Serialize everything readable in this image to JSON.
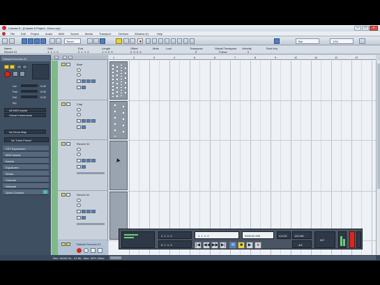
{
  "window": {
    "title": "Cubase 5 - [Cubase 5 Project - Demo.cpr]",
    "controls": [
      "–",
      "□",
      "×"
    ]
  },
  "menu": {
    "items": [
      "File",
      "Edit",
      "Project",
      "Audio",
      "MIDI",
      "Scores",
      "Media",
      "Transport",
      "Devices",
      "Window (1)",
      "Help"
    ]
  },
  "toolbar": {
    "mode_select": "Touch",
    "grid_select": "Bar",
    "quantize_select": "1/16"
  },
  "infoline": {
    "headers": [
      "Name",
      "Start",
      "End",
      "Length",
      "Offset",
      "Mute",
      "Lock",
      "Transpose",
      "Global Transpose",
      "Velocity",
      "Root Key"
    ],
    "values": [
      "Reverb 01",
      "1. 1. 1. 0",
      "2. 1. 1. 0",
      "1. 0. 0. 0",
      "0. 0. 0. 0",
      "",
      "",
      "0",
      "Follow",
      "0",
      "-"
    ]
  },
  "inspector": {
    "track_name": "Default Grooves 01",
    "fields": [
      "Vol",
      "Pan",
      "Del",
      "Inp"
    ],
    "values": [
      "0.00",
      "0.00",
      "0.00",
      ""
    ],
    "routing": [
      "All MIDI Inputs",
      "Virtual Instruments"
    ],
    "drum_map": "No Drum Map",
    "device": "No Track Preset",
    "sections": [
      "VST Expression",
      "MIDI Inserts",
      "Inserts",
      "Equalizers",
      "Sends",
      "Channel",
      "Notepad",
      "Quick Controls"
    ]
  },
  "tracks": [
    {
      "name": "Beat"
    },
    {
      "name": "Clap"
    },
    {
      "name": "Reverb 01"
    },
    {
      "name": "Reverb 02"
    },
    {
      "name": "Default Grooves 01"
    }
  ],
  "ruler": {
    "marks": [
      "1",
      "2",
      "3",
      "4",
      "5",
      "6",
      "7",
      "8",
      "9",
      "10",
      "11",
      "12",
      "13"
    ]
  },
  "transport": {
    "position_primary": "1. 1. 1. 0",
    "position_secondary": "0000:00.000",
    "left_locator": "1. 1. 1. 0",
    "right_locator": "5. 1. 1. 0",
    "tempo": "120.000",
    "signature": "4/4",
    "click": "CLICK",
    "sync": "INT"
  },
  "statusbar": {
    "text": "Rec: 44100 Hz - 24 Bit - Max: 307h 25min"
  },
  "colors": {
    "desktop": "#000000",
    "titlebar": "#dbe4ee",
    "inspector_bg": "#3f4f62",
    "track_list_bg": "#c9d2dc",
    "track_strip": "#7fb98a",
    "event_block": "#8d98a4",
    "grid_bg": "#eef1f5",
    "transport_bg": "#4a5563",
    "record_red": "#d9281e",
    "accent_yellow": "#e8d23a"
  }
}
